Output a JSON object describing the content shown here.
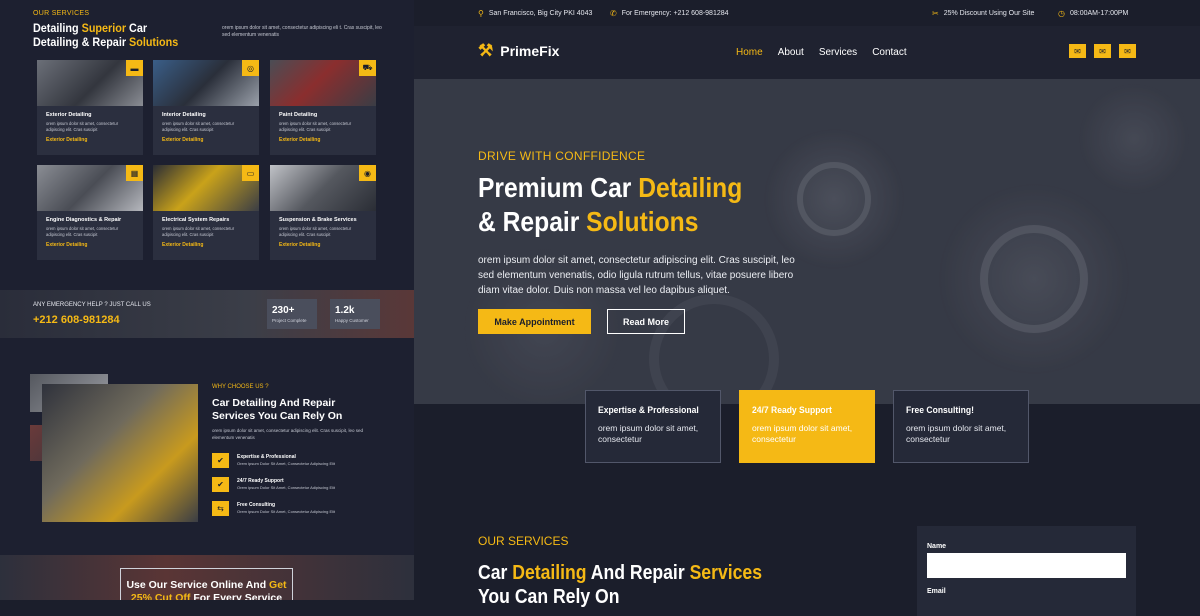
{
  "left_preview": {
    "services": {
      "eyebrow": "OUR SERVICES",
      "title_part1": "Detailing ",
      "title_highlight1": "Superior",
      "title_part2": " Car Detailing & Repair ",
      "title_highlight2": "Solutions",
      "description": "orem ipsum dolor sit amet, consectetur adipiscing eli t. Cras suscipit, leo sed elementum venenatis",
      "cards": [
        {
          "title": "Exterior Detailing",
          "desc": "orem ipsum dolor sit amet, consectetur adipiscing elit. Cras suscipit",
          "link": "Exterior Detailing",
          "icon": "paint-roller-icon"
        },
        {
          "title": "Interior Detailing",
          "desc": "orem ipsum dolor sit amet, consectetur adipiscing elit. Cras suscipit",
          "link": "Exterior Detailing",
          "icon": "steering-wheel-icon"
        },
        {
          "title": "Paint Detailing",
          "desc": "orem ipsum dolor sit amet, consectetur adipiscing elit. Cras suscipit",
          "link": "Exterior Detailing",
          "icon": "car-icon"
        },
        {
          "title": "Engine Diagnostics & Repair",
          "desc": "orem ipsum dolor sit amet, consectetur adipiscing elit. Cras suscipit",
          "link": "Exterior Detailing",
          "icon": "engine-icon"
        },
        {
          "title": "Electrical System Repairs",
          "desc": "orem ipsum dolor sit amet, consectetur adipiscing elit. Cras suscipit",
          "link": "Exterior Detailing",
          "icon": "battery-icon"
        },
        {
          "title": "Suspension & Brake Services",
          "desc": "orem ipsum dolor sit amet, consectetur adipiscing elit. Cras suscipit",
          "link": "Exterior Detailing",
          "icon": "brake-icon"
        }
      ]
    },
    "emergency": {
      "label": "ANY EMERGENCY HELP ? JUST CALL US",
      "phone": "+212 608-981284",
      "stats": [
        {
          "number": "230+",
          "label": "Project Complete"
        },
        {
          "number": "1.2k",
          "label": "Happy Customer"
        }
      ]
    },
    "why": {
      "eyebrow": "WHY CHOOSE US ?",
      "title": "Car Detailing And Repair Services You Can Rely On",
      "description": "orem ipsum dolor sit amet, consectetur adipiscing elit. Cras suscipit, leo sed elementum venenatis",
      "features": [
        {
          "title": "Expertise & Professional",
          "desc": "Orem ipsum Dolor Sit Amet, Consectetur Adipiscing Elit",
          "icon": "check-icon"
        },
        {
          "title": "24/7 Ready Support",
          "desc": "Orem ipsum Dolor Sit Amet, Consectetur Adipiscing Elit",
          "icon": "check-icon"
        },
        {
          "title": "Free Consulting",
          "desc": "Orem ipsum Dolor Sit Amet, Consectetur Adipiscing Elit",
          "icon": "consulting-icon"
        }
      ]
    },
    "online": {
      "line1": "Use Our Service Online And ",
      "line1_highlight": "Get",
      "line2_highlight": "25% Cut Off",
      "line2": " For Every Service"
    }
  },
  "topbar": {
    "address": "San Francisco, Big City PKI 4043",
    "emergency": "For Emergency: +212 608-981284",
    "discount": "25% Discount Using Our Site",
    "hours": "08:00AM-17:00PM"
  },
  "nav": {
    "brand": "PrimeFix",
    "items": [
      "Home",
      "About",
      "Services",
      "Contact"
    ]
  },
  "hero": {
    "eyebrow": "DRIVE WITH CONFFIDENCE",
    "title_part1": "Premium Car ",
    "title_highlight1": "Detailing",
    "title_part2": " & Repair ",
    "title_highlight2": "Solutions",
    "description": "orem ipsum dolor sit amet, consectetur adipiscing elit. Cras suscipit, leo sed elementum venenatis, odio ligula rutrum tellus, vitae posuere libero diam vitae dolor. Duis non massa vel leo dapibus aliquet.",
    "primary_button": "Make Appointment",
    "secondary_button": "Read More"
  },
  "features": [
    {
      "title": "Expertise & Professional",
      "desc": "orem ipsum dolor sit amet, consectetur"
    },
    {
      "title": "24/7 Ready Support",
      "desc": "orem ipsum dolor sit amet, consectetur"
    },
    {
      "title": "Free Consulting!",
      "desc": "orem ipsum dolor sit amet, consectetur"
    }
  ],
  "our_services": {
    "eyebrow": "OUR SERVICES",
    "title_part1": "Car ",
    "title_highlight1": "Detailing",
    "title_part2": " And Repair ",
    "title_highlight2": "Services",
    "title_part3": "You Can Rely On"
  },
  "form": {
    "name_label": "Name",
    "email_label": "Email"
  },
  "colors": {
    "accent": "#f5b915",
    "background": "#1b1e2b"
  }
}
